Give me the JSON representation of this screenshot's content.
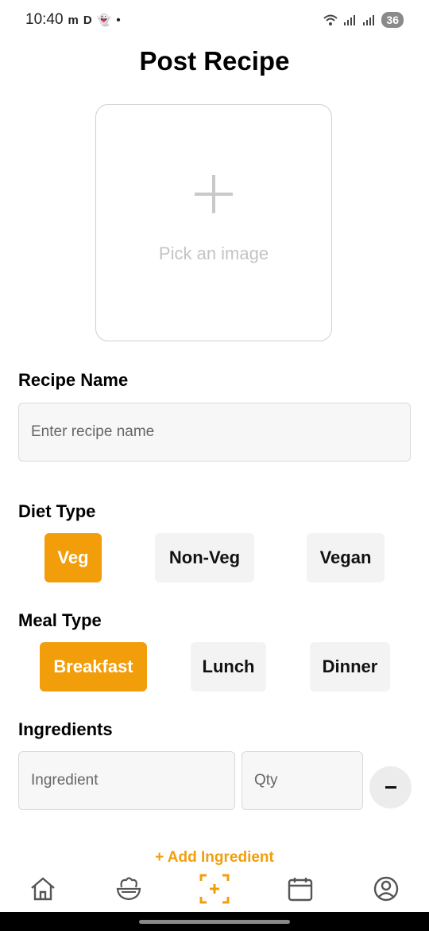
{
  "status_bar": {
    "time": "10:40",
    "icons_left": [
      "m",
      "D",
      "👻",
      "•"
    ],
    "battery": "36"
  },
  "page": {
    "title": "Post Recipe"
  },
  "image_picker": {
    "label": "Pick an image"
  },
  "recipe_name": {
    "label": "Recipe Name",
    "placeholder": "Enter recipe name",
    "value": ""
  },
  "diet_type": {
    "label": "Diet Type",
    "options": [
      "Veg",
      "Non-Veg",
      "Vegan"
    ],
    "selected": "Veg"
  },
  "meal_type": {
    "label": "Meal Type",
    "options": [
      "Breakfast",
      "Lunch",
      "Dinner"
    ],
    "selected": "Breakfast"
  },
  "ingredients": {
    "label": "Ingredients",
    "ingredient_placeholder": "Ingredient",
    "qty_placeholder": "Qty",
    "remove_label": "−",
    "add_label": "+ Add Ingredient"
  },
  "bottom_nav": {
    "items": [
      "home-icon",
      "recipes-icon",
      "post-icon",
      "calendar-icon",
      "profile-icon"
    ]
  },
  "colors": {
    "accent": "#f29e0b",
    "chip_bg": "#f3f3f3",
    "input_bg": "#f7f7f7"
  }
}
